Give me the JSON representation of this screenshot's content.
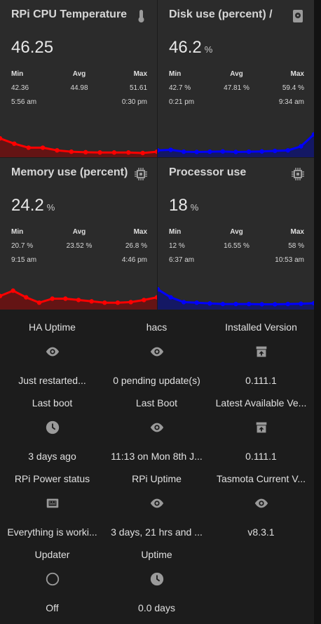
{
  "cards": [
    {
      "title": "RPi CPU Temperature",
      "icon": "thermometer-icon",
      "value": "46.25",
      "unit": "",
      "labels": [
        "Min",
        "Avg",
        "Max"
      ],
      "values": [
        "42.36",
        "44.98",
        "51.61"
      ],
      "times": [
        "5:56 am",
        "",
        "0:30 pm"
      ],
      "color": "#ff0000",
      "fill": "#6e1010",
      "trend": [
        0.55,
        0.35,
        0.2,
        0.2,
        0.1,
        0.05,
        0.03,
        0.02,
        0.02,
        0.02,
        0.0,
        0.05
      ]
    },
    {
      "title": "Disk use (percent) /",
      "icon": "harddisk-icon",
      "value": "46.2",
      "unit": "%",
      "labels": [
        "Min",
        "Avg",
        "Max"
      ],
      "values": [
        "42.7 %",
        "47.81 %",
        "59.4 %"
      ],
      "times": [
        "0:21 pm",
        "",
        "9:34 am"
      ],
      "color": "#0000ff",
      "fill": "#10156e",
      "trend": [
        0.1,
        0.12,
        0.05,
        0.04,
        0.05,
        0.06,
        0.04,
        0.05,
        0.06,
        0.08,
        0.1,
        0.25,
        0.7
      ]
    },
    {
      "title": "Memory use (percent)",
      "icon": "chip-icon",
      "value": "24.2",
      "unit": "%",
      "labels": [
        "Min",
        "Avg",
        "Max"
      ],
      "values": [
        "20.7 %",
        "23.52 %",
        "26.8 %"
      ],
      "times": [
        "9:15 am",
        "",
        "4:46 pm"
      ],
      "color": "#ff0000",
      "fill": "#6e1010",
      "trend": [
        0.35,
        0.55,
        0.3,
        0.1,
        0.25,
        0.25,
        0.2,
        0.15,
        0.1,
        0.1,
        0.12,
        0.2,
        0.3
      ]
    },
    {
      "title": "Processor use",
      "icon": "chip-icon",
      "value": "18",
      "unit": "%",
      "labels": [
        "Min",
        "Avg",
        "Max"
      ],
      "values": [
        "12 %",
        "16.55 %",
        "58 %"
      ],
      "times": [
        "6:37 am",
        "",
        "10:53 am"
      ],
      "color": "#0000ff",
      "fill": "#10156e",
      "trend": [
        0.6,
        0.3,
        0.12,
        0.1,
        0.07,
        0.05,
        0.05,
        0.05,
        0.04,
        0.04,
        0.05,
        0.06,
        0.08
      ]
    }
  ],
  "glance": [
    {
      "name": "HA Uptime",
      "icon": "eye-icon",
      "state": "Just restarted..."
    },
    {
      "name": "hacs",
      "icon": "eye-icon",
      "state": "0 pending update(s)"
    },
    {
      "name": "Installed Version",
      "icon": "package-up-icon",
      "state": "0.111.1"
    },
    {
      "name": "Last boot",
      "icon": "clock-icon",
      "state": "3 days ago"
    },
    {
      "name": "Last Boot",
      "icon": "eye-icon",
      "state": "11:13 on Mon 8th J..."
    },
    {
      "name": "Latest Available Ve...",
      "icon": "package-up-icon",
      "state": "0.111.1"
    },
    {
      "name": "RPi Power status",
      "icon": "raspberry-icon",
      "state": "Everything is worki..."
    },
    {
      "name": "RPi Uptime",
      "icon": "eye-icon",
      "state": "3 days, 21 hrs and ..."
    },
    {
      "name": "Tasmota Current V...",
      "icon": "eye-icon",
      "state": "v8.3.1"
    },
    {
      "name": "Updater",
      "icon": "circle-outline-icon",
      "state": "Off"
    },
    {
      "name": "Uptime",
      "icon": "clock-icon",
      "state": "0.0 days"
    }
  ]
}
